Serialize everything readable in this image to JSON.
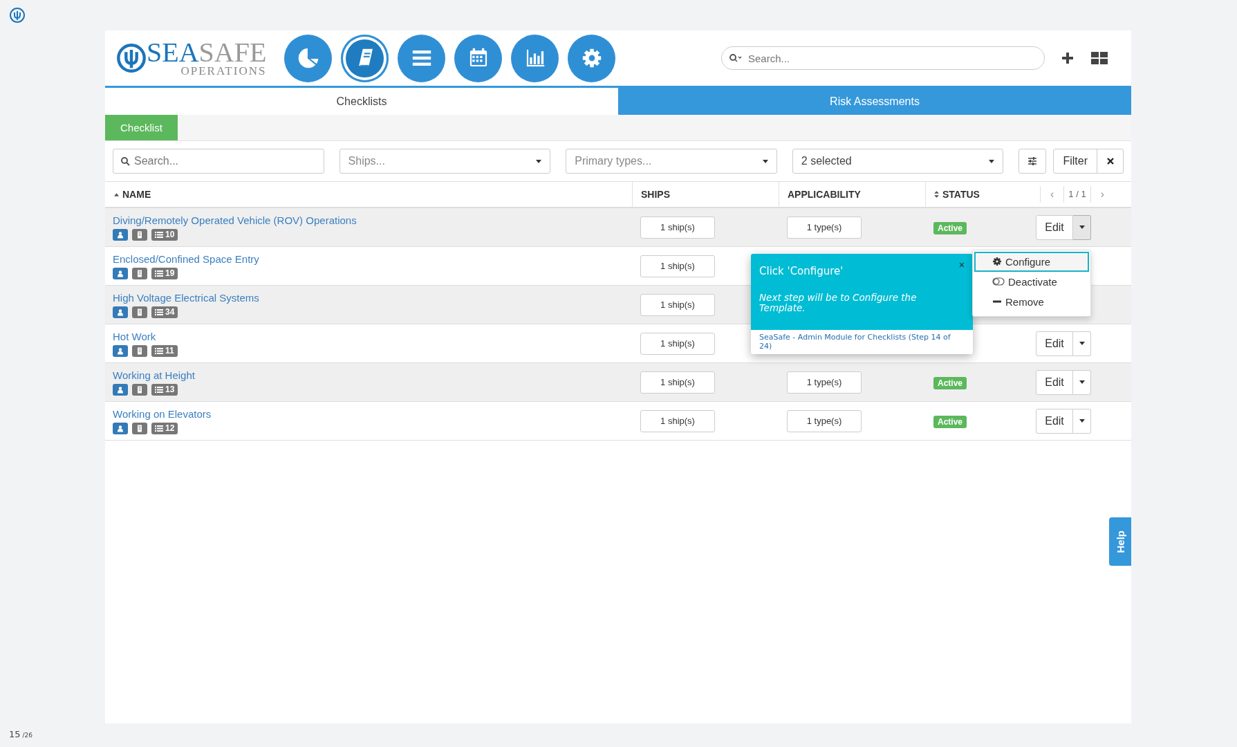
{
  "logo": {
    "word_1": "SEA",
    "word_2": "SAFE",
    "tagline": "OPERATIONS"
  },
  "nav": [
    {
      "kind": "pie",
      "selected": false
    },
    {
      "kind": "book",
      "selected": true
    },
    {
      "kind": "list",
      "selected": false
    },
    {
      "kind": "calendar",
      "selected": false
    },
    {
      "kind": "bars",
      "selected": false
    },
    {
      "kind": "gear",
      "selected": false
    }
  ],
  "search": {
    "placeholder": "Search..."
  },
  "tabs": [
    {
      "label": "Checklists",
      "selected": true
    },
    {
      "label": "Risk Assessments",
      "selected": false
    }
  ],
  "subtabs": [
    {
      "label": "Checklist",
      "selected": true
    }
  ],
  "filters": {
    "search_placeholder": "Search...",
    "dropdowns": [
      {
        "placeholder": "Ships..."
      },
      {
        "placeholder": "Primary types..."
      },
      {
        "value": "2 selected"
      }
    ],
    "filter_button": "Filter"
  },
  "columns": [
    {
      "label": "NAME",
      "sortable": true,
      "sorted": true
    },
    {
      "label": "SHIPS",
      "sortable": false,
      "sorted": false
    },
    {
      "label": "APPLICABILITY",
      "sortable": false,
      "sorted": false
    },
    {
      "label": "STATUS",
      "sortable": true,
      "sorted": false
    }
  ],
  "pager": {
    "prev": "‹",
    "label": "1 / 1",
    "next": "›"
  },
  "rows": [
    {
      "name": "Diving/Remotely Operated Vehicle (ROV) Operations",
      "count": "10",
      "ships": "1 ship(s)",
      "applicability": "1 type(s)",
      "status": "Active",
      "edit": "Edit",
      "menu_open": true
    },
    {
      "name": "Enclosed/Confined Space Entry",
      "count": "19",
      "ships": "1 ship(s)"
    },
    {
      "name": "High Voltage Electrical Systems",
      "count": "34",
      "ships": "1 ship(s)"
    },
    {
      "name": "Hot Work",
      "count": "11",
      "ships": "1 ship(s)",
      "edit": "Edit",
      "menu_open": false
    },
    {
      "name": "Working at Height",
      "count": "13",
      "ships": "1 ship(s)",
      "applicability": "1 type(s)",
      "status": "Active",
      "edit": "Edit",
      "menu_open": false
    },
    {
      "name": "Working on Elevators",
      "count": "12",
      "ships": "1 ship(s)",
      "applicability": "1 type(s)",
      "status": "Active",
      "edit": "Edit",
      "menu_open": false
    }
  ],
  "menu": [
    {
      "kind": "gear",
      "label": "Configure",
      "selected": true
    },
    {
      "kind": "toggle",
      "label": "Deactivate",
      "selected": false
    },
    {
      "kind": "minus",
      "label": "Remove",
      "selected": false
    }
  ],
  "tour": {
    "title": "Click 'Configure'",
    "body": "Next step will be to Configure the Template.",
    "footer": "SeaSafe - Admin Module for Checklists (Step 14 of 24)",
    "close": "×"
  },
  "help": "Help",
  "page": {
    "current": "15",
    "total": "/26"
  }
}
